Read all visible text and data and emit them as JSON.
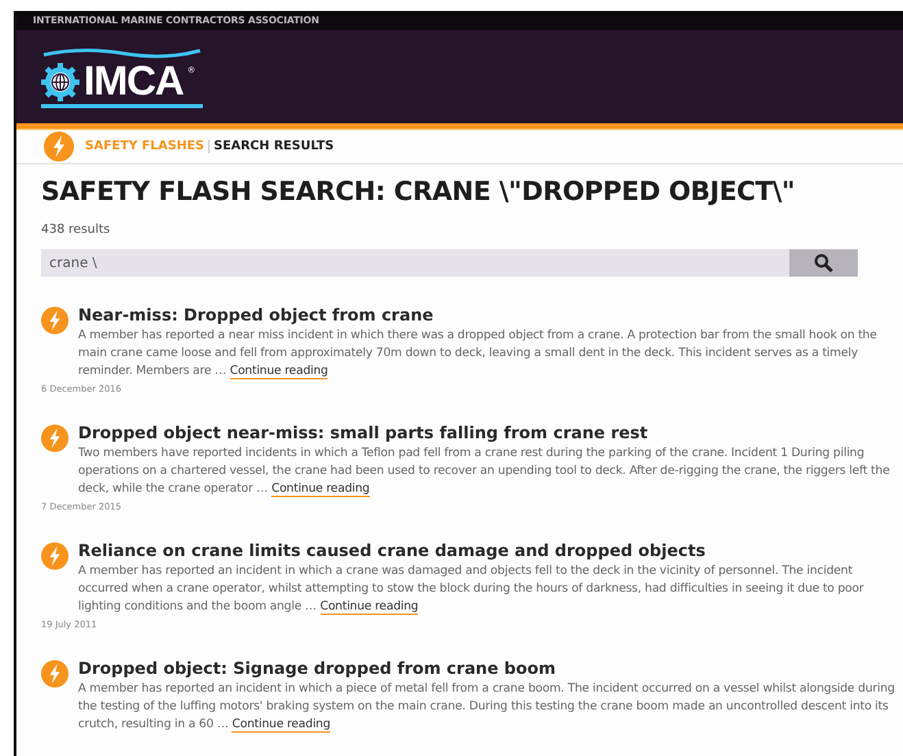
{
  "top_bar": {
    "text": "INTERNATIONAL MARINE CONTRACTORS ASSOCIATION"
  },
  "logo": {
    "text": "IMCA",
    "mark": "®"
  },
  "breadcrumb": [
    {
      "label": "SAFETY FLASHES",
      "selected": false
    },
    {
      "label": "SEARCH RESULTS",
      "selected": true
    }
  ],
  "title": "SAFETY FLASH SEARCH: CRANE \\\"DROPPED OBJECT\\\"",
  "result_count": "438 results",
  "search": {
    "value": "crane \\"
  },
  "results": [
    {
      "title": "Near-miss: Dropped object from crane",
      "excerpt": "A member has reported a near miss incident in which there was a dropped object from a crane.  A protection bar from the small hook on the main crane came loose and fell from approximately 70m down to deck, leaving a small dent in the deck. This incident serves as a timely reminder.  Members are …",
      "link": "Continue reading",
      "date": "6 December 2016"
    },
    {
      "title": "Dropped object near-miss: small parts falling from crane rest",
      "excerpt": "Two members have reported incidents in which a Teflon pad fell from a crane rest during the parking of the crane. Incident 1 During piling operations on a chartered vessel, the crane had been used to recover an upending tool to deck. After de-rigging the crane, the riggers left the deck, while the crane operator …",
      "link": "Continue reading",
      "date": "7 December 2015"
    },
    {
      "title": "Reliance on crane limits caused crane damage and dropped objects",
      "excerpt": "A member has reported an incident in which a crane was damaged and objects fell to the deck in the vicinity of personnel. The incident occurred when a crane operator, whilst attempting to stow the block during the hours of darkness, had difficulties in seeing it due to poor lighting conditions and the boom angle …",
      "link": "Continue reading",
      "date": "19 July 2011"
    },
    {
      "title": "Dropped object: Signage dropped from crane boom",
      "excerpt": "A member has reported an incident in which a piece of metal fell from a crane boom. The incident occurred on a vessel whilst alongside during the testing of the luffing motors' braking system on the main crane. During this testing the crane boom made an uncontrolled descent into its crutch, resulting in a 60 …",
      "link": "Continue reading"
    }
  ]
}
